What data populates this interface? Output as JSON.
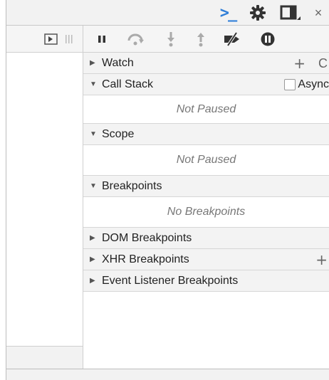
{
  "topbar": {
    "icons": [
      "console-icon",
      "gear-icon",
      "dock-icon",
      "close-icon"
    ],
    "console_glyph": ">_",
    "close_glyph": "×"
  },
  "toolbar": {
    "icons": [
      "toggle-navigator-icon",
      "pause-icon",
      "step-over-icon",
      "step-into-icon",
      "step-out-icon",
      "deactivate-breakpoints-icon",
      "pause-on-exceptions-icon"
    ]
  },
  "sidebar": {
    "watch": {
      "label": "Watch",
      "add_glyph": "+",
      "refresh_glyph": "C"
    },
    "call_stack": {
      "label": "Call Stack",
      "async_label": "Async",
      "body": "Not Paused"
    },
    "scope": {
      "label": "Scope",
      "body": "Not Paused"
    },
    "breakpoints": {
      "label": "Breakpoints",
      "body": "No Breakpoints"
    },
    "dom_breakpoints": {
      "label": "DOM Breakpoints"
    },
    "xhr_breakpoints": {
      "label": "XHR Breakpoints",
      "add_glyph": "+"
    },
    "event_listener_breakpoints": {
      "label": "Event Listener Breakpoints"
    }
  },
  "colors": {
    "accent": "#2f7ed8",
    "header_bg": "#f3f3f3",
    "icon": "#333333",
    "muted": "#777777"
  }
}
